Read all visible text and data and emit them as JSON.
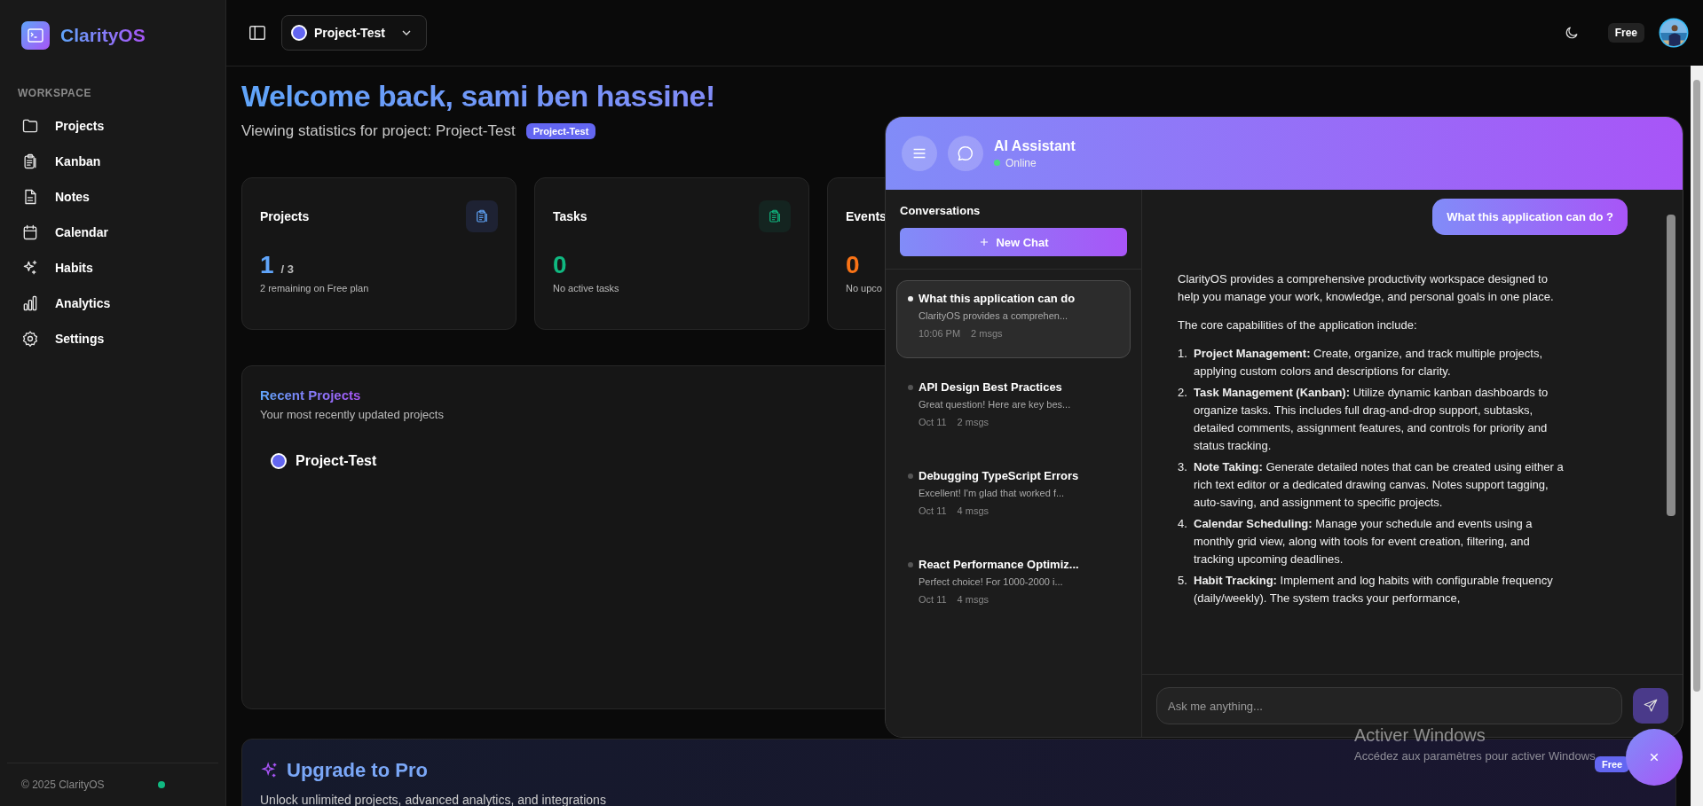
{
  "sidebar": {
    "brand": "ClarityOS",
    "section": "WORKSPACE",
    "items": [
      {
        "label": "Projects"
      },
      {
        "label": "Kanban"
      },
      {
        "label": "Notes"
      },
      {
        "label": "Calendar"
      },
      {
        "label": "Habits"
      },
      {
        "label": "Analytics"
      },
      {
        "label": "Settings"
      }
    ],
    "footer": "© 2025 ClarityOS"
  },
  "topbar": {
    "project": "Project-Test",
    "plan": "Free"
  },
  "welcome": {
    "title": "Welcome back, sami ben hassine!",
    "subtitle": "Viewing statistics for project: Project-Test",
    "tag": "Project-Test"
  },
  "stats": [
    {
      "label": "Projects",
      "value": "1",
      "suffix": "/ 3",
      "note": "2 remaining on Free plan",
      "color": "#60a5fa"
    },
    {
      "label": "Tasks",
      "value": "0",
      "note": "No active tasks",
      "color": "#10b981"
    },
    {
      "label": "Events",
      "value": "0",
      "note": "No upco",
      "color": "#f97316"
    }
  ],
  "recent": {
    "title": "Recent Projects",
    "subtitle": "Your most recently updated projects",
    "projects": [
      {
        "name": "Project-Test"
      }
    ]
  },
  "upgrade": {
    "title": "Upgrade to Pro",
    "text": "Unlock unlimited projects, advanced analytics, and integrations",
    "badge": "Free"
  },
  "chat": {
    "title": "AI Assistant",
    "status": "Online",
    "conversations_title": "Conversations",
    "new_chat": "New Chat",
    "conversations": [
      {
        "title": "What this application can do",
        "preview": "ClarityOS provides a comprehen...",
        "time": "10:06 PM",
        "count": "2 msgs",
        "selected": true
      },
      {
        "title": "API Design Best Practices",
        "preview": "Great question! Here are key bes...",
        "time": "Oct 11",
        "count": "2 msgs",
        "selected": false
      },
      {
        "title": "Debugging TypeScript Errors",
        "preview": "Excellent! I'm glad that worked f...",
        "time": "Oct 11",
        "count": "4 msgs",
        "selected": false
      },
      {
        "title": "React Performance Optimiz...",
        "preview": "Perfect choice! For 1000-2000 i...",
        "time": "Oct 11",
        "count": "4 msgs",
        "selected": false
      }
    ],
    "user_message": "What this application can do ?",
    "answer": {
      "paragraphs": [
        "ClarityOS provides a comprehensive productivity workspace designed to help you manage your work, knowledge, and personal goals in one place.",
        "The core capabilities of the application include:"
      ],
      "list": [
        {
          "number": "1.",
          "text": "**Project Management:** Create, organize, and track multiple projects, applying custom colors and descriptions for clarity."
        },
        {
          "number": "2.",
          "text": "**Task Management (Kanban):** Utilize dynamic kanban dashboards to organize tasks. This includes full drag-and-drop support, subtasks, detailed comments, assignment features, and controls for priority and status tracking."
        },
        {
          "number": "3.",
          "text": "**Note Taking:** Generate detailed notes that can be created using either a rich text editor or a dedicated drawing canvas. Notes support tagging, auto-saving, and assignment to specific projects."
        },
        {
          "number": "4.",
          "text": "**Calendar Scheduling:** Manage your schedule and events using a monthly grid view, along with tools for event creation, filtering, and tracking upcoming deadlines."
        },
        {
          "number": "5.",
          "text": "**Habit Tracking:** Implement and log habits with configurable frequency (daily/weekly). The system tracks your performance,"
        }
      ]
    },
    "input_placeholder": "Ask me anything..."
  },
  "os_notice": {
    "title": "Activer Windows",
    "text": "Accédez aux paramètres pour activer Windows"
  }
}
